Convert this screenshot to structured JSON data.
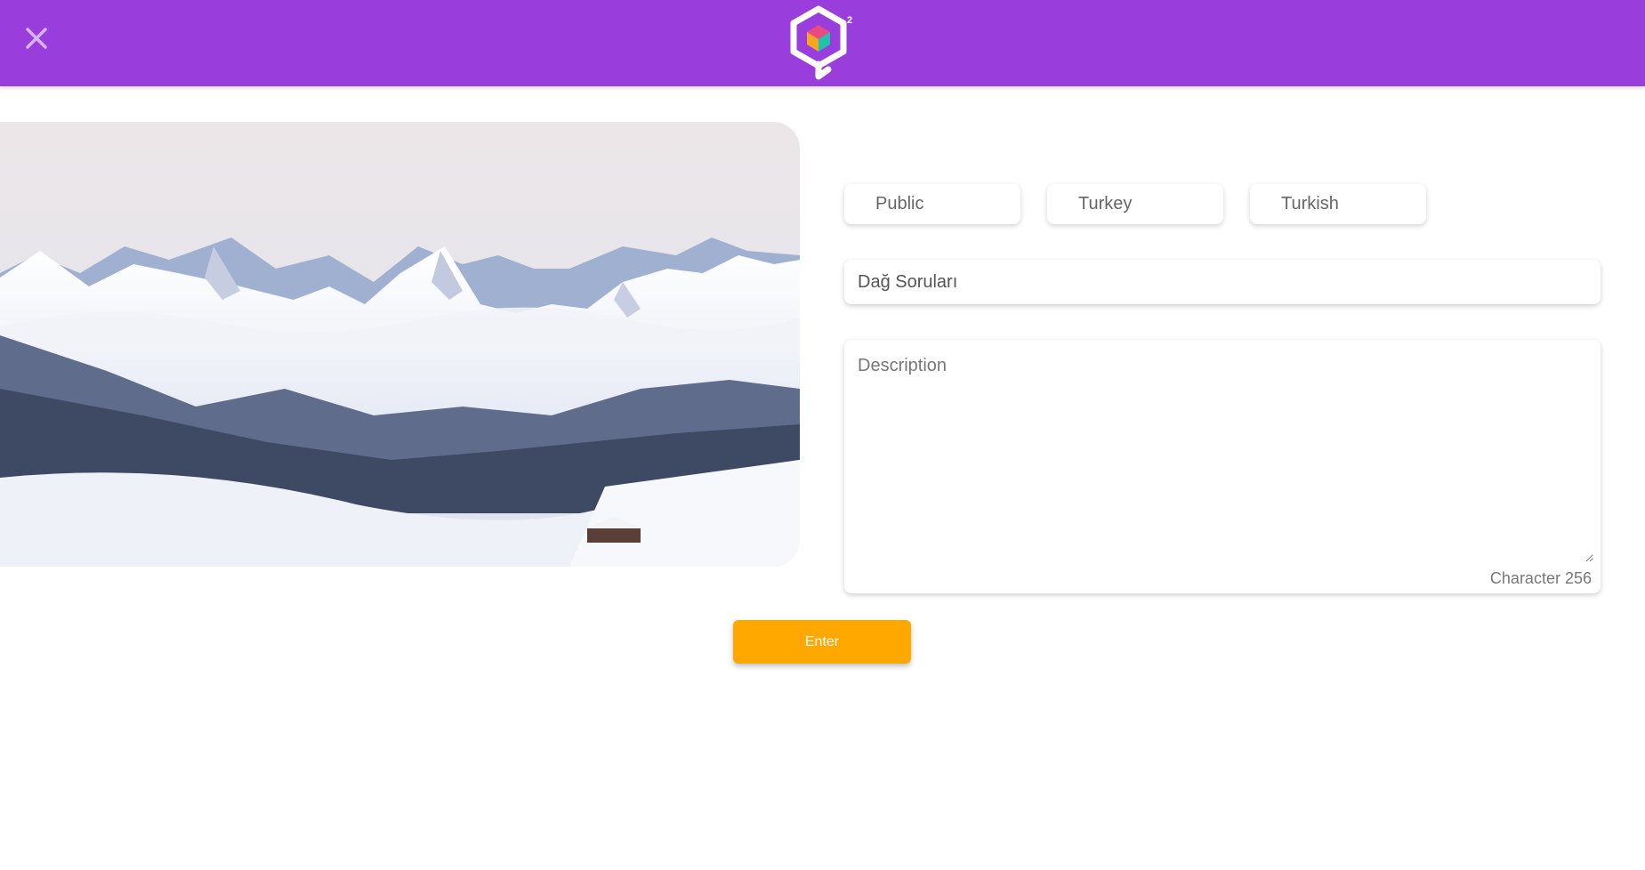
{
  "header": {
    "close_icon": "close-icon",
    "logo_icon": "cube-logo-icon",
    "logo_superscript": "2",
    "brand_color": "#9a3ddd"
  },
  "hero_image": {
    "icon": "snowy-mountain-landscape"
  },
  "form": {
    "visibility": "Public",
    "country": "Turkey",
    "language": "Turkish",
    "title_value": "Dağ Soruları",
    "description_placeholder": "Description",
    "description_value": "",
    "char_counter": "Character 256",
    "enter_label": "Enter",
    "accent_color": "#ffa800"
  }
}
